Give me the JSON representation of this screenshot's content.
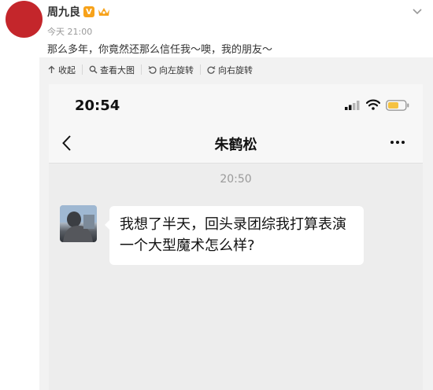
{
  "post": {
    "author": "周九良",
    "verified_badge": "V",
    "time": "今天 21:00",
    "text": "那么多年，你竟然还那么信任我～噢，我的朋友～"
  },
  "toolbar": {
    "collapse": "收起",
    "view_large": "查看大图",
    "rotate_left": "向左旋转",
    "rotate_right": "向右旋转"
  },
  "phone": {
    "status_time": "20:54",
    "contact_name": "朱鹤松",
    "message_time": "20:50",
    "message_text": "我想了半天，回头录团综我打算表演一个大型魔术怎么样?"
  },
  "colors": {
    "avatar": "#c4262b",
    "badge": "#f7a21a",
    "battery": "#f5c242"
  },
  "icons": [
    "avatar",
    "verified-v-icon",
    "crown-icon",
    "chevron-down-icon",
    "collapse-arrow-icon",
    "magnifier-icon",
    "rotate-left-icon",
    "rotate-right-icon",
    "signal-icon",
    "wifi-icon",
    "battery-icon",
    "back-arrow-icon",
    "more-dots-icon"
  ]
}
